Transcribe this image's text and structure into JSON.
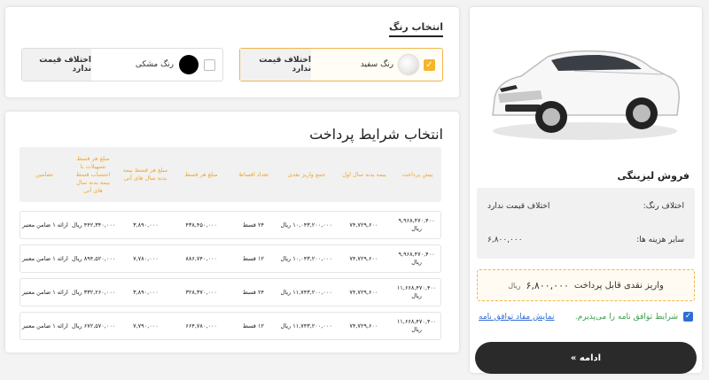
{
  "product": {
    "title": "فروش لیزینگی",
    "color_diff_label": "اختلاف رنگ:",
    "color_diff_value": "اختلاف قیمت ندارد",
    "other_costs_label": "سایر هزینه ها:",
    "other_costs_value": "۶,۸۰۰,۰۰۰",
    "cash_label": "واریز نقدی قابل پرداخت",
    "cash_value": "۶,۸۰۰,۰۰۰",
    "cash_currency": "ریال",
    "agree_text": "شرایط توافق نامه را می‌پذیرم.",
    "agree_link": "نمایش مفاد توافق نامه",
    "continue_label": "ادامه »"
  },
  "colors": {
    "title": "انتخاب رنگ",
    "options": [
      {
        "name": "رنگ سفید",
        "diff": "اختلاف قیمت ندارد",
        "selected": true
      },
      {
        "name": "رنگ مشکی",
        "diff": "اختلاف قیمت ندارد",
        "selected": false
      }
    ]
  },
  "payment": {
    "title": "انتخاب شرایط پرداخت",
    "headers": [
      "پیش پرداخت",
      "بیمه بدنه سال اول",
      "جمع واریز نقدی",
      "تعداد اقساط",
      "مبلغ هر قسط",
      "مبلغ هر قسط بیمه بدنه سال های آتی",
      "مبلغ هر قسط تسهیلات با احتساب قسط بیمه بدنه سال های آتی",
      "تضامین"
    ],
    "rows": [
      [
        "۹,۹۶۸,۴۷۰,۴۰۰ ریال",
        "۷۴,۷۲۹,۶۰۰",
        "۱۰,۰۴۳,۲۰۰,۰۰۰ ریال",
        "۲۴ قسط",
        "۴۳۸,۴۵۰,۰۰۰",
        "۳,۸۹۰,۰۰۰",
        "۴۴۲,۳۴۰,۰۰۰ ریال",
        "ارائه ۱ ضامن معتبر"
      ],
      [
        "۹,۹۶۸,۴۷۰,۴۰۰ ریال",
        "۷۴,۷۲۹,۶۰۰",
        "۱۰,۰۴۳,۲۰۰,۰۰۰ ریال",
        "۱۲ قسط",
        "۸۸۶,۷۴۰,۰۰۰",
        "۷,۷۸۰,۰۰۰",
        "۸۹۴,۵۲۰,۰۰۰ ریال",
        "ارائه ۱ ضامن معتبر"
      ],
      [
        "۱۱,۶۶۸,۴۷۰,۴۰۰ ریال",
        "۷۴,۷۲۹,۶۰۰",
        "۱۱,۷۴۳,۲۰۰,۰۰۰ ریال",
        "۲۴ قسط",
        "۳۲۸,۳۷۰,۰۰۰",
        "۳,۸۹۰,۰۰۰",
        "۳۳۲,۲۶۰,۰۰۰ ریال",
        "ارائه ۱ ضامن معتبر"
      ],
      [
        "۱۱,۶۶۸,۴۷۰,۴۰۰ ریال",
        "۷۴,۷۲۹,۶۰۰",
        "۱۱,۷۴۳,۲۰۰,۰۰۰ ریال",
        "۱۲ قسط",
        "۶۶۴,۷۸۰,۰۰۰",
        "۷,۷۹۰,۰۰۰",
        "۶۷۲,۵۷۰,۰۰۰ ریال",
        "ارائه ۱ ضامن معتبر"
      ]
    ]
  },
  "theme": {
    "accent": "#f0b44c",
    "link": "#2f6cd8",
    "dark": "#2a2a2a"
  }
}
